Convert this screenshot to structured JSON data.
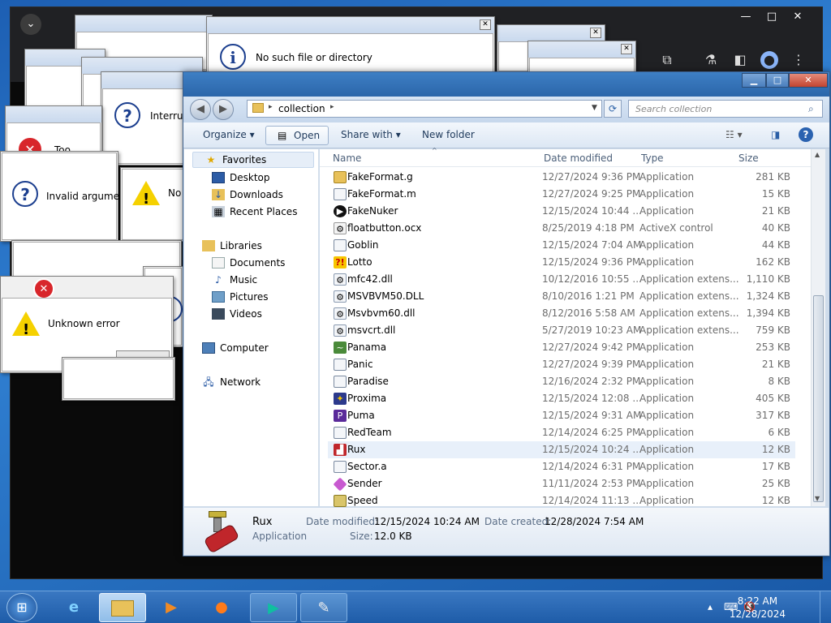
{
  "browser": {
    "minimize": "—",
    "maximize": "□",
    "close": "✕"
  },
  "dialogs": [
    {
      "name": "dialog-no-such-file",
      "text": "No such file or directory",
      "icon": "info-icon"
    },
    {
      "name": "dialog-interrupt",
      "text": "Interrupt",
      "icon": "question-icon"
    },
    {
      "name": "dialog-invalid-argument",
      "text": "Invalid argument",
      "icon": "question-icon"
    },
    {
      "name": "dialog-no",
      "text": "No",
      "icon": "warning-icon"
    },
    {
      "name": "dialog-too",
      "text": "Too",
      "icon": "error-icon"
    },
    {
      "name": "dialog-unknown-error",
      "text": "Unknown error",
      "icon": "warning-icon"
    }
  ],
  "explorer": {
    "address": {
      "crumb": "collection"
    },
    "search_placeholder": "Search collection",
    "toolbar": {
      "organize": "Organize",
      "open": "Open",
      "share_with": "Share with",
      "new_folder": "New folder"
    },
    "nav": {
      "favorites": "Favorites",
      "desktop": "Desktop",
      "downloads": "Downloads",
      "recent_places": "Recent Places",
      "libraries": "Libraries",
      "documents": "Documents",
      "music": "Music",
      "pictures": "Pictures",
      "videos": "Videos",
      "computer": "Computer",
      "network": "Network"
    },
    "columns": {
      "name": "Name",
      "date": "Date modified",
      "type": "Type",
      "size": "Size"
    },
    "files": [
      {
        "name": "FakeFormat.g",
        "date": "12/27/2024 9:36 PM",
        "type": "Application",
        "size": "281 KB",
        "icon": "folder-exe-icon"
      },
      {
        "name": "FakeFormat.m",
        "date": "12/27/2024 9:25 PM",
        "type": "Application",
        "size": "15 KB",
        "icon": "exe-icon"
      },
      {
        "name": "FakeNuker",
        "date": "12/15/2024 10:44 ...",
        "type": "Application",
        "size": "21 KB",
        "icon": "play-icon"
      },
      {
        "name": "floatbutton.ocx",
        "date": "8/25/2019 4:18 PM",
        "type": "ActiveX control",
        "size": "40 KB",
        "icon": "ocx-icon"
      },
      {
        "name": "Goblin",
        "date": "12/15/2024 7:04 AM",
        "type": "Application",
        "size": "44 KB",
        "icon": "exe-icon"
      },
      {
        "name": "Lotto",
        "date": "12/15/2024 9:36 PM",
        "type": "Application",
        "size": "162 KB",
        "icon": "lotto-icon"
      },
      {
        "name": "mfc42.dll",
        "date": "10/12/2016 10:55 ...",
        "type": "Application extens...",
        "size": "1,110 KB",
        "icon": "dll-icon"
      },
      {
        "name": "MSVBVM50.DLL",
        "date": "8/10/2016 1:21 PM",
        "type": "Application extens...",
        "size": "1,324 KB",
        "icon": "dll-icon"
      },
      {
        "name": "Msvbvm60.dll",
        "date": "8/12/2016 5:58 AM",
        "type": "Application extens...",
        "size": "1,394 KB",
        "icon": "dll-icon"
      },
      {
        "name": "msvcrt.dll",
        "date": "5/27/2019 10:23 AM",
        "type": "Application extens...",
        "size": "759 KB",
        "icon": "dll-icon"
      },
      {
        "name": "Panama",
        "date": "12/27/2024 9:42 PM",
        "type": "Application",
        "size": "253 KB",
        "icon": "panama-icon"
      },
      {
        "name": "Panic",
        "date": "12/27/2024 9:39 PM",
        "type": "Application",
        "size": "21 KB",
        "icon": "exe-icon"
      },
      {
        "name": "Paradise",
        "date": "12/16/2024 2:32 PM",
        "type": "Application",
        "size": "8 KB",
        "icon": "exe-icon"
      },
      {
        "name": "Proxima",
        "date": "12/15/2024 12:08 ...",
        "type": "Application",
        "size": "405 KB",
        "icon": "proxima-icon"
      },
      {
        "name": "Puma",
        "date": "12/15/2024 9:31 AM",
        "type": "Application",
        "size": "317 KB",
        "icon": "puma-icon"
      },
      {
        "name": "RedTeam",
        "date": "12/14/2024 6:25 PM",
        "type": "Application",
        "size": "6 KB",
        "icon": "exe-icon"
      },
      {
        "name": "Rux",
        "date": "12/15/2024 10:24 ...",
        "type": "Application",
        "size": "12 KB",
        "icon": "rux-icon",
        "selected": true
      },
      {
        "name": "Sector.a",
        "date": "12/14/2024 6:31 PM",
        "type": "Application",
        "size": "17 KB",
        "icon": "exe-icon"
      },
      {
        "name": "Sender",
        "date": "11/11/2024 2:53 PM",
        "type": "Application",
        "size": "25 KB",
        "icon": "sender-icon"
      },
      {
        "name": "Speed",
        "date": "12/14/2024 11:13 ...",
        "type": "Application",
        "size": "12 KB",
        "icon": "speed-icon"
      }
    ],
    "details": {
      "name": "Rux",
      "kind": "Application",
      "date_modified_label": "Date modified:",
      "date_modified": "12/15/2024 10:24 AM",
      "date_created_label": "Date created:",
      "date_created": "12/28/2024 7:54 AM",
      "size_label": "Size:",
      "size": "12.0 KB"
    }
  },
  "taskbar": {
    "time": "8:22 AM",
    "date": "12/28/2024"
  }
}
